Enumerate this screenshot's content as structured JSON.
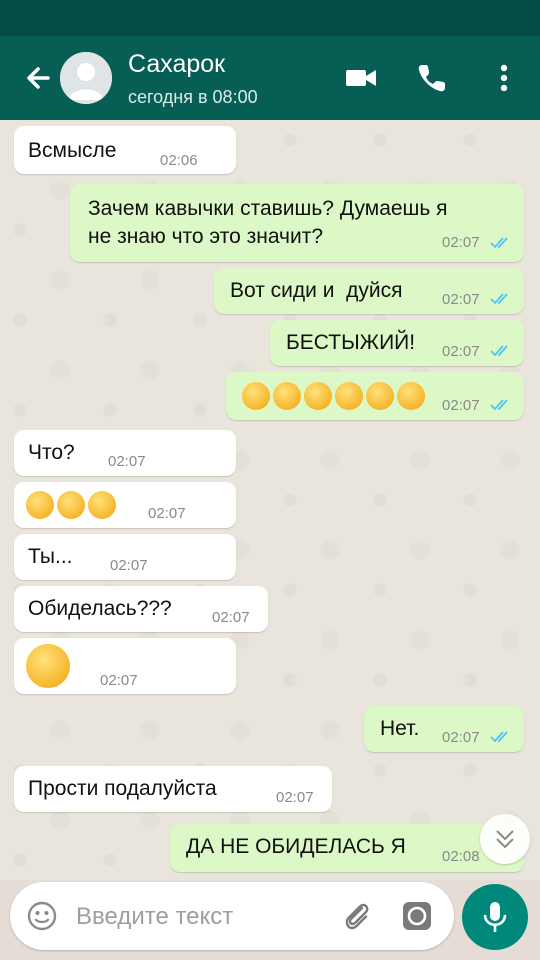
{
  "header": {
    "contact_name": "Сахарок",
    "last_seen": "сегодня в 08:00",
    "icons": [
      "back-arrow-icon",
      "video-call-icon",
      "phone-icon",
      "more-vert-icon"
    ]
  },
  "messages": [
    {
      "dir": "in",
      "text": "Всмысле",
      "time": "02:06"
    },
    {
      "dir": "out",
      "text": "Зачем кавычки ставишь? Думаешь я\nне знаю что это значит?",
      "time": "02:07",
      "read": true
    },
    {
      "dir": "out",
      "text": "Вот сиди и  дуйся",
      "time": "02:07",
      "read": true
    },
    {
      "dir": "out",
      "text": "БЕСТЫЖИЙ!",
      "time": "02:07",
      "read": true
    },
    {
      "dir": "out",
      "emoji": "unamused-face x6",
      "time": "02:07",
      "read": true
    },
    {
      "dir": "in",
      "text": "Что?",
      "time": "02:07"
    },
    {
      "dir": "in",
      "emoji": "astonished-face x3",
      "time": "02:07"
    },
    {
      "dir": "in",
      "text": "Ты...",
      "time": "02:07"
    },
    {
      "dir": "in",
      "text": "Обиделась???",
      "time": "02:07"
    },
    {
      "dir": "in",
      "emoji": "worried-face",
      "time": "02:07"
    },
    {
      "dir": "out",
      "text": "Нет.",
      "time": "02:07",
      "read": true
    },
    {
      "dir": "in",
      "text": "Прости подалуйста",
      "time": "02:07"
    },
    {
      "dir": "out",
      "text": "ДА НЕ ОБИДЕЛАСЬ Я",
      "time": "02:08",
      "read": true
    }
  ],
  "composer": {
    "placeholder": "Введите текст",
    "icons": [
      "emoji-icon",
      "attach-icon",
      "camera-icon",
      "mic-icon"
    ]
  },
  "colors": {
    "appbar": "#075e54",
    "statusbar": "#054c44",
    "outgoing_bubble": "#dcf8c6",
    "incoming_bubble": "#ffffff",
    "read_ticks": "#4fc3f7",
    "fab": "#00897b"
  }
}
